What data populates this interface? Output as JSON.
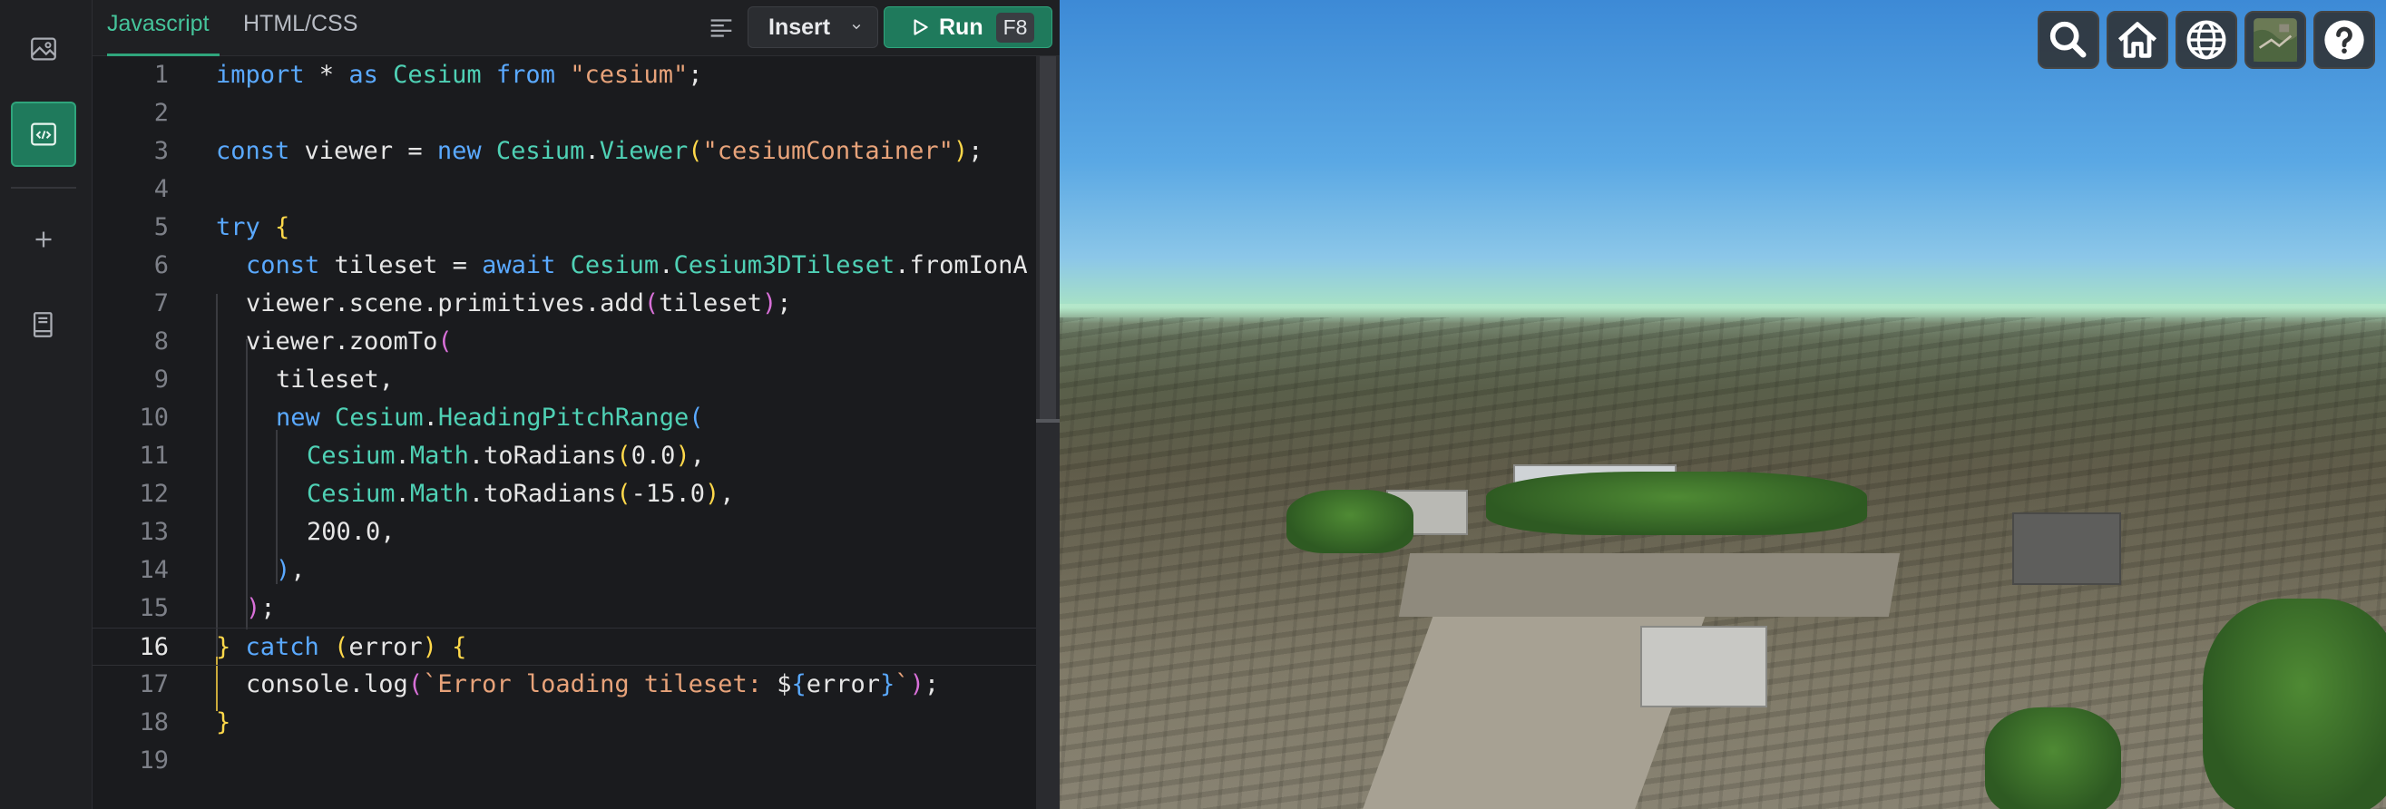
{
  "tabs": {
    "javascript": "Javascript",
    "htmlcss": "HTML/CSS"
  },
  "toolbar": {
    "insert_label": "Insert",
    "run_label": "Run",
    "run_shortcut": "F8"
  },
  "rail": {
    "items": [
      "gallery-icon",
      "code-icon",
      "add-icon",
      "docs-icon"
    ],
    "active": "code-icon"
  },
  "viewer_toolbar": [
    "search-icon",
    "home-icon",
    "globe-icon",
    "imagery-icon",
    "help-icon"
  ],
  "editor": {
    "current_line": 16,
    "line_numbers": [
      "1",
      "2",
      "3",
      "4",
      "5",
      "6",
      "7",
      "8",
      "9",
      "10",
      "11",
      "12",
      "13",
      "14",
      "15",
      "16",
      "17",
      "18",
      "19"
    ],
    "lines": {
      "l1": {
        "kw1": "import",
        "t1": " * ",
        "kw2": "as",
        "t2": " ",
        "c1": "Cesium",
        "t3": " ",
        "kw3": "from",
        "t4": " ",
        "s1": "\"cesium\"",
        "t5": ";"
      },
      "l3": {
        "kw1": "const",
        "t1": " viewer = ",
        "kw2": "new",
        "t2": " ",
        "c1": "Cesium",
        "t3": ".",
        "c2": "Viewer",
        "b1": "(",
        "s1": "\"cesiumContainer\"",
        "b2": ")",
        "t4": ";"
      },
      "l5": {
        "kw1": "try",
        "t1": " ",
        "b1": "{"
      },
      "l6": {
        "kw1": "const",
        "t1": " tileset = ",
        "kw2": "await",
        "t2": " ",
        "c1": "Cesium",
        "t3": ".",
        "c2": "Cesium3DTileset",
        "t4": ".fromIonA"
      },
      "l7": {
        "t1": "viewer.scene.primitives.add",
        "b1": "(",
        "t2": "tileset",
        "b2": ")",
        "t3": ";"
      },
      "l8": {
        "t1": "viewer.zoomTo",
        "b1": "("
      },
      "l9": {
        "t1": "tileset,"
      },
      "l10": {
        "kw1": "new",
        "t1": " ",
        "c1": "Cesium",
        "t2": ".",
        "c2": "HeadingPitchRange",
        "b1": "("
      },
      "l11": {
        "c1": "Cesium",
        "t1": ".",
        "c2": "Math",
        "t2": ".toRadians",
        "b1": "(",
        "t3": "0.0",
        "b2": ")",
        "t4": ","
      },
      "l12": {
        "c1": "Cesium",
        "t1": ".",
        "c2": "Math",
        "t2": ".toRadians",
        "b1": "(",
        "t3": "-15.0",
        "b2": ")",
        "t4": ","
      },
      "l13": {
        "t1": "200.0,"
      },
      "l14": {
        "b1": ")",
        "t1": ","
      },
      "l15": {
        "b1": ")",
        "t1": ";"
      },
      "l16": {
        "b1": "}",
        "t1": " ",
        "kw1": "catch",
        "t2": " ",
        "b2": "(",
        "t3": "error",
        "b3": ")",
        "t4": " ",
        "b4": "{"
      },
      "l17": {
        "t1": "console.log",
        "b1": "(",
        "s1": "`Error loading tileset: ",
        "t2": "$",
        "b2": "{",
        "t3": "error",
        "b3": "}",
        "s2": "`",
        "b4": ")",
        "t4": ";"
      },
      "l18": {
        "b1": "}"
      }
    }
  }
}
